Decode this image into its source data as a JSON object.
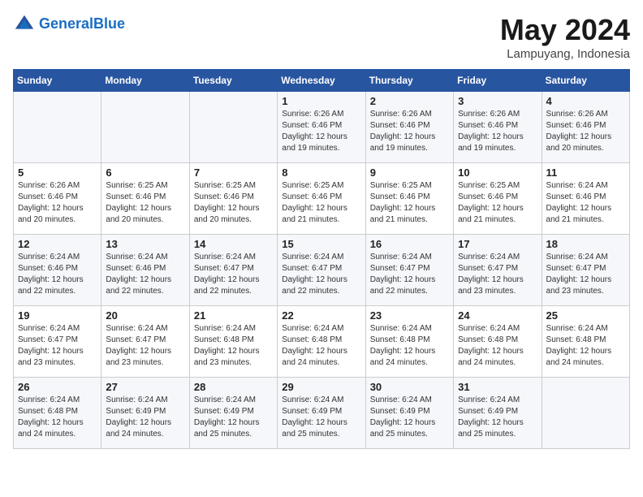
{
  "header": {
    "logo_line1": "General",
    "logo_line2": "Blue",
    "month": "May 2024",
    "location": "Lampuyang, Indonesia"
  },
  "days_of_week": [
    "Sunday",
    "Monday",
    "Tuesday",
    "Wednesday",
    "Thursday",
    "Friday",
    "Saturday"
  ],
  "weeks": [
    [
      {
        "day": "",
        "info": ""
      },
      {
        "day": "",
        "info": ""
      },
      {
        "day": "",
        "info": ""
      },
      {
        "day": "1",
        "info": "Sunrise: 6:26 AM\nSunset: 6:46 PM\nDaylight: 12 hours and 19 minutes."
      },
      {
        "day": "2",
        "info": "Sunrise: 6:26 AM\nSunset: 6:46 PM\nDaylight: 12 hours and 19 minutes."
      },
      {
        "day": "3",
        "info": "Sunrise: 6:26 AM\nSunset: 6:46 PM\nDaylight: 12 hours and 19 minutes."
      },
      {
        "day": "4",
        "info": "Sunrise: 6:26 AM\nSunset: 6:46 PM\nDaylight: 12 hours and 20 minutes."
      }
    ],
    [
      {
        "day": "5",
        "info": "Sunrise: 6:26 AM\nSunset: 6:46 PM\nDaylight: 12 hours and 20 minutes."
      },
      {
        "day": "6",
        "info": "Sunrise: 6:25 AM\nSunset: 6:46 PM\nDaylight: 12 hours and 20 minutes."
      },
      {
        "day": "7",
        "info": "Sunrise: 6:25 AM\nSunset: 6:46 PM\nDaylight: 12 hours and 20 minutes."
      },
      {
        "day": "8",
        "info": "Sunrise: 6:25 AM\nSunset: 6:46 PM\nDaylight: 12 hours and 21 minutes."
      },
      {
        "day": "9",
        "info": "Sunrise: 6:25 AM\nSunset: 6:46 PM\nDaylight: 12 hours and 21 minutes."
      },
      {
        "day": "10",
        "info": "Sunrise: 6:25 AM\nSunset: 6:46 PM\nDaylight: 12 hours and 21 minutes."
      },
      {
        "day": "11",
        "info": "Sunrise: 6:24 AM\nSunset: 6:46 PM\nDaylight: 12 hours and 21 minutes."
      }
    ],
    [
      {
        "day": "12",
        "info": "Sunrise: 6:24 AM\nSunset: 6:46 PM\nDaylight: 12 hours and 22 minutes."
      },
      {
        "day": "13",
        "info": "Sunrise: 6:24 AM\nSunset: 6:46 PM\nDaylight: 12 hours and 22 minutes."
      },
      {
        "day": "14",
        "info": "Sunrise: 6:24 AM\nSunset: 6:47 PM\nDaylight: 12 hours and 22 minutes."
      },
      {
        "day": "15",
        "info": "Sunrise: 6:24 AM\nSunset: 6:47 PM\nDaylight: 12 hours and 22 minutes."
      },
      {
        "day": "16",
        "info": "Sunrise: 6:24 AM\nSunset: 6:47 PM\nDaylight: 12 hours and 22 minutes."
      },
      {
        "day": "17",
        "info": "Sunrise: 6:24 AM\nSunset: 6:47 PM\nDaylight: 12 hours and 23 minutes."
      },
      {
        "day": "18",
        "info": "Sunrise: 6:24 AM\nSunset: 6:47 PM\nDaylight: 12 hours and 23 minutes."
      }
    ],
    [
      {
        "day": "19",
        "info": "Sunrise: 6:24 AM\nSunset: 6:47 PM\nDaylight: 12 hours and 23 minutes."
      },
      {
        "day": "20",
        "info": "Sunrise: 6:24 AM\nSunset: 6:47 PM\nDaylight: 12 hours and 23 minutes."
      },
      {
        "day": "21",
        "info": "Sunrise: 6:24 AM\nSunset: 6:48 PM\nDaylight: 12 hours and 23 minutes."
      },
      {
        "day": "22",
        "info": "Sunrise: 6:24 AM\nSunset: 6:48 PM\nDaylight: 12 hours and 24 minutes."
      },
      {
        "day": "23",
        "info": "Sunrise: 6:24 AM\nSunset: 6:48 PM\nDaylight: 12 hours and 24 minutes."
      },
      {
        "day": "24",
        "info": "Sunrise: 6:24 AM\nSunset: 6:48 PM\nDaylight: 12 hours and 24 minutes."
      },
      {
        "day": "25",
        "info": "Sunrise: 6:24 AM\nSunset: 6:48 PM\nDaylight: 12 hours and 24 minutes."
      }
    ],
    [
      {
        "day": "26",
        "info": "Sunrise: 6:24 AM\nSunset: 6:48 PM\nDaylight: 12 hours and 24 minutes."
      },
      {
        "day": "27",
        "info": "Sunrise: 6:24 AM\nSunset: 6:49 PM\nDaylight: 12 hours and 24 minutes."
      },
      {
        "day": "28",
        "info": "Sunrise: 6:24 AM\nSunset: 6:49 PM\nDaylight: 12 hours and 25 minutes."
      },
      {
        "day": "29",
        "info": "Sunrise: 6:24 AM\nSunset: 6:49 PM\nDaylight: 12 hours and 25 minutes."
      },
      {
        "day": "30",
        "info": "Sunrise: 6:24 AM\nSunset: 6:49 PM\nDaylight: 12 hours and 25 minutes."
      },
      {
        "day": "31",
        "info": "Sunrise: 6:24 AM\nSunset: 6:49 PM\nDaylight: 12 hours and 25 minutes."
      },
      {
        "day": "",
        "info": ""
      }
    ]
  ]
}
